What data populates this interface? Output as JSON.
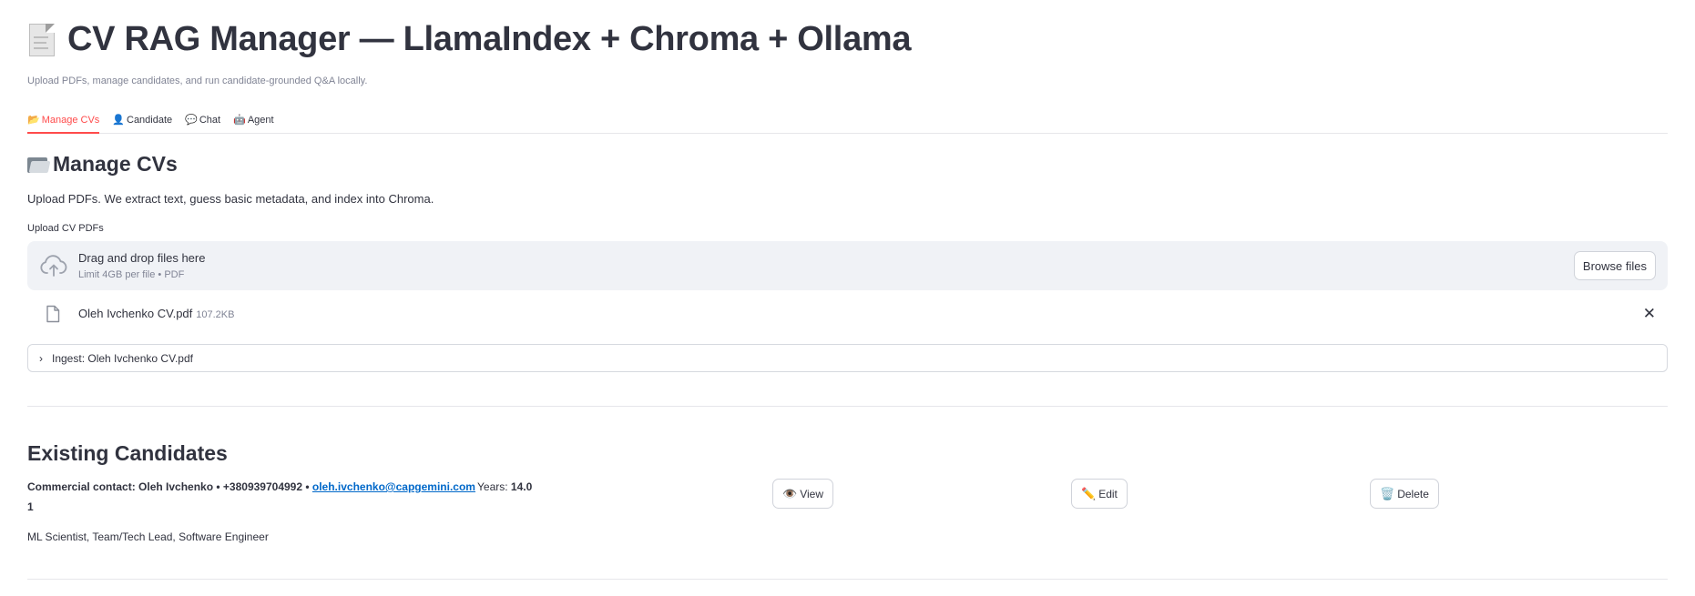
{
  "app": {
    "title": "CV RAG Manager — LlamaIndex + Chroma + Ollama",
    "subtitle": "Upload PDFs, manage candidates, and run candidate-grounded Q&A locally."
  },
  "tabs": [
    {
      "icon": "📂",
      "label": "Manage CVs",
      "active": true
    },
    {
      "icon": "👤",
      "label": "Candidate",
      "active": false
    },
    {
      "icon": "💬",
      "label": "Chat",
      "active": false
    },
    {
      "icon": "🤖",
      "label": "Agent",
      "active": false
    }
  ],
  "manage": {
    "heading": "Manage CVs",
    "description": "Upload PDFs. We extract text, guess basic metadata, and index into Chroma.",
    "upload_label": "Upload CV PDFs",
    "dropzone": {
      "main_text": "Drag and drop files here",
      "sub_text": "Limit 4GB per file • PDF",
      "browse_label": "Browse files"
    },
    "file": {
      "name": "Oleh Ivchenko CV.pdf",
      "size": "107.2KB",
      "close_symbol": "✕"
    },
    "expander": {
      "chevron": "›",
      "label": "Ingest: Oleh Ivchenko CV.pdf"
    }
  },
  "existing": {
    "heading": "Existing Candidates",
    "candidate": {
      "contact_prefix": "Commercial contact: Oleh Ivchenko • +380939704992 • ",
      "email": "oleh.ivchenko@capgemini.com",
      "years_label": "Years: ",
      "years_value": "14.0",
      "index": "1",
      "roles": "ML Scientist, Team/Tech Lead, Software Engineer"
    },
    "buttons": {
      "view": {
        "icon": "👁️",
        "label": "View"
      },
      "edit": {
        "icon": "✏️",
        "label": "Edit"
      },
      "delete": {
        "icon": "🗑️",
        "label": "Delete"
      }
    }
  },
  "colors": {
    "accent": "#ff4b4b",
    "link": "#0068c9",
    "text": "#31333f",
    "muted": "#808495",
    "dropzone_bg": "#f0f2f6"
  }
}
